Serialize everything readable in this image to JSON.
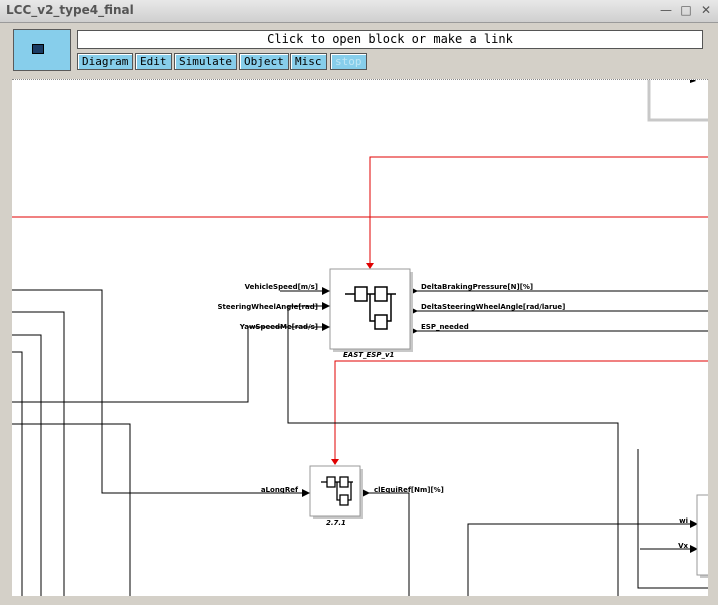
{
  "window": {
    "title": "LCC_v2_type4_final",
    "minimize_glyph": "—",
    "maximize_glyph": "□",
    "close_glyph": "✕"
  },
  "toolbar": {
    "message": "Click to open block or make a link",
    "menus": [
      "Diagram",
      "Edit",
      "Simulate",
      "Object",
      "Misc",
      "stop"
    ]
  },
  "diagram": {
    "block_esp": {
      "caption": "EAST_ESP_v1",
      "inputs": [
        "VehicleSpeed[m/s]",
        "SteeringWheelAngle[rad]",
        "YawSpeedMe[rad/s]"
      ],
      "outputs": [
        "DeltaBrakingPressure[N][%]",
        "DeltaSteeringWheelAngle[rad/larue]",
        "ESP_needed"
      ]
    },
    "block_2": {
      "caption": "2.7.1",
      "input": "aLongRef",
      "output": "clEquiRef[Nm][%]"
    },
    "right_block_inputs": [
      "wi",
      "Vx"
    ],
    "colors": {
      "signal": "#000000",
      "event": "#e00000",
      "block_shadow": "#c8c8c8",
      "menu": "#87ceeb"
    }
  }
}
